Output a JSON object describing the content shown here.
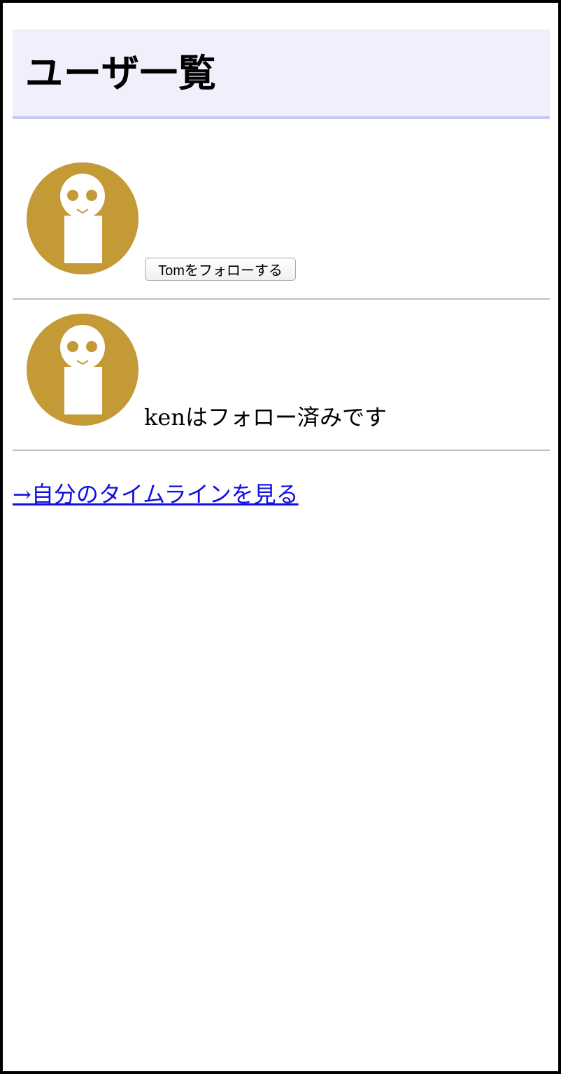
{
  "header": {
    "title": "ユーザ一覧"
  },
  "users": [
    {
      "follow_button_label": "Tomをフォローする",
      "avatar_icon": "user-avatar-icon"
    },
    {
      "status_text": "kenはフォロー済みです",
      "avatar_icon": "user-avatar-icon"
    }
  ],
  "footer": {
    "timeline_link": "→自分のタイムラインを見る"
  },
  "colors": {
    "header_bg": "#f0f0fc",
    "header_border": "#c6c8f8",
    "avatar_bg": "#c49a36",
    "link": "#1010e0"
  }
}
